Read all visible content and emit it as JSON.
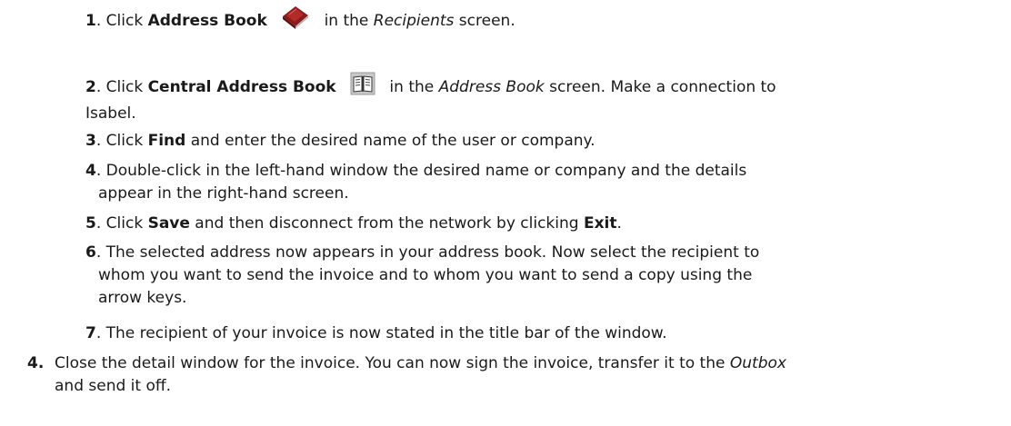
{
  "steps": [
    {
      "num": "1",
      "before": ". Click ",
      "bold1": "Address Book",
      "after": " in the ",
      "italic": "Recipients",
      "end": " screen.",
      "icon": "address-book-icon"
    },
    {
      "num": "2",
      "before": ". Click ",
      "bold1": "Central Address Book",
      "after": " in the ",
      "italic": "Address Book",
      "end": " screen. Make a connection to",
      "line2": "Isabel.",
      "icon": "central-address-book-icon"
    },
    {
      "num": "3",
      "before": ". Click ",
      "bold1": "Find",
      "end": " and enter the desired name of the user or company."
    },
    {
      "num": "4",
      "text": ". Double-click in the left-hand window the desired name or company and the details",
      "line2": "appear in the right-hand screen."
    },
    {
      "num": "5",
      "before": ". Click ",
      "bold1": "Save",
      "mid": " and then disconnect from the network by clicking ",
      "bold2": "Exit",
      "end": "."
    },
    {
      "num": "6",
      "text": ". The selected address now appears in your address book. Now select the recipient to",
      "line2": "whom you want to send the invoice and to whom you want to send a copy using the",
      "line3": "arrow keys."
    },
    {
      "num": "7",
      "text": ". The recipient of your invoice is now stated in the title bar of the window."
    }
  ],
  "outer_step": {
    "num": "4.",
    "text1": "Close the detail window for the invoice. You can now sign the invoice, transfer it to the ",
    "italic": "Outbox",
    "line2": "and send it off."
  }
}
